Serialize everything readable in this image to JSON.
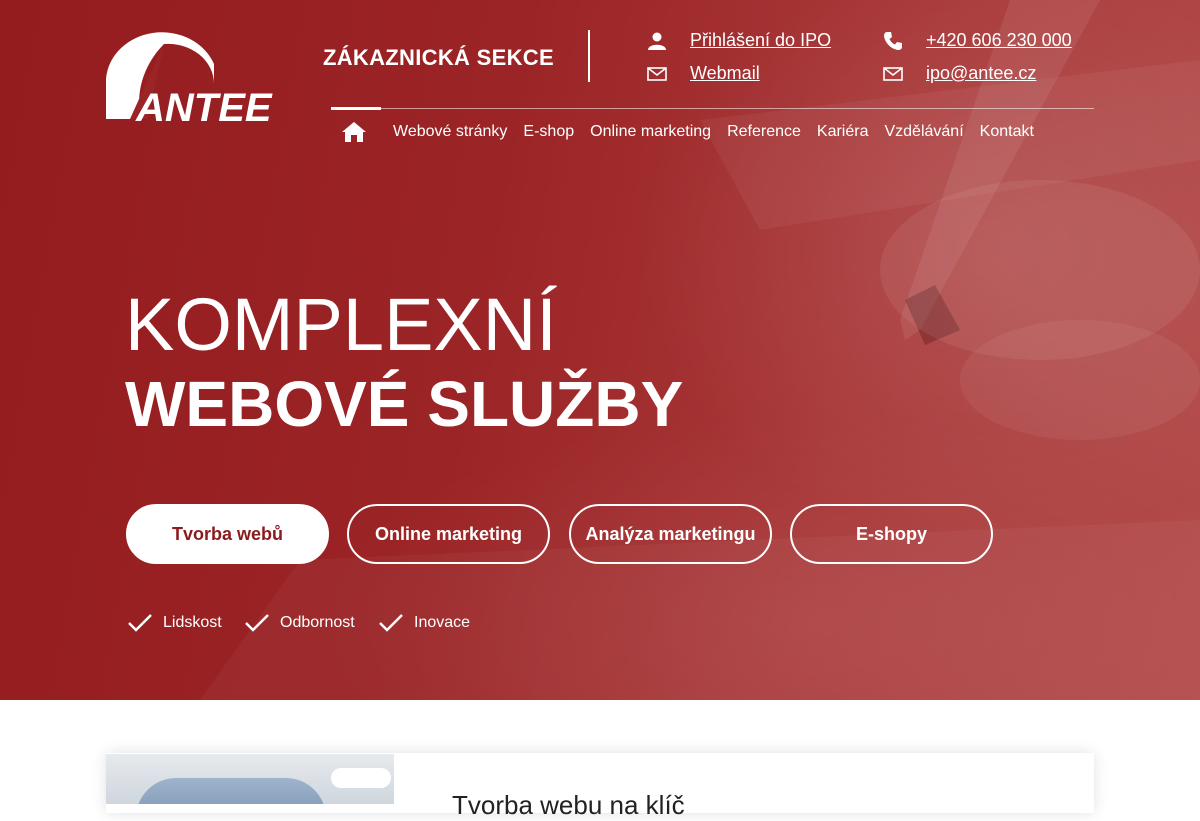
{
  "brand": {
    "name": "ANTEE",
    "color": "#9b2426"
  },
  "header": {
    "customer_section": "ZÁKAZNICKÁ SEKCE",
    "ipo_login": "Přihlášení do IPO",
    "webmail": "Webmail",
    "phone": "+420 606 230 000",
    "email": "ipo@antee.cz"
  },
  "nav": {
    "home_icon": "home-icon",
    "items": [
      "Webové stránky",
      "E-shop",
      "Online marketing",
      "Reference",
      "Kariéra",
      "Vzdělávání",
      "Kontakt"
    ]
  },
  "hero": {
    "line1": "KOMPLEXNÍ",
    "line2": "WEBOVÉ SLUŽBY",
    "buttons": [
      "Tvorba webů",
      "Online marketing",
      "Analýza marketingu",
      "E-shopy"
    ],
    "values": [
      "Lidskost",
      "Odbornost",
      "Inovace"
    ]
  },
  "section": {
    "title": "Tvorba webu na klíč"
  },
  "icons": [
    "user-icon",
    "mail-icon",
    "phone-icon",
    "check-icon"
  ]
}
